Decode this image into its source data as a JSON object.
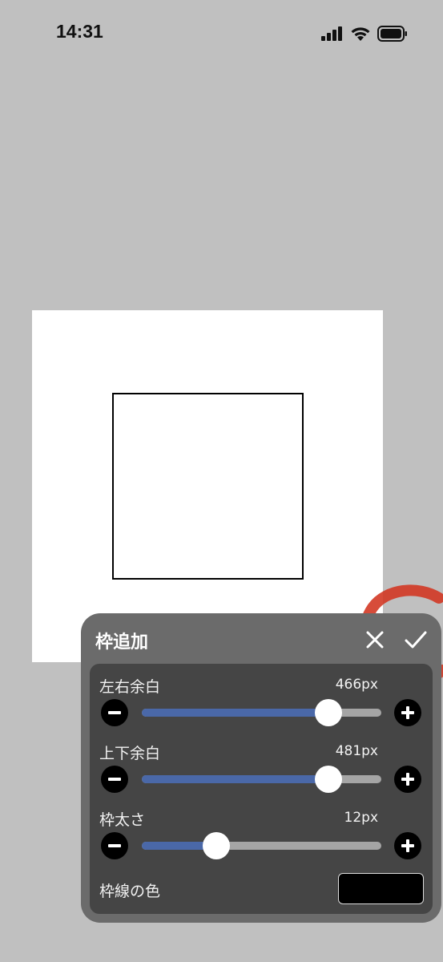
{
  "status_bar": {
    "time": "14:31",
    "icons": [
      "cellular-signal-icon",
      "wifi-icon",
      "battery-icon"
    ]
  },
  "canvas": {
    "background": "#ffffff",
    "frame_color": "#000000"
  },
  "panel": {
    "title": "枠追加",
    "close_icon": "close-icon",
    "confirm_icon": "checkmark-icon",
    "rows": [
      {
        "label": "左右余白",
        "value": "466px",
        "fill_fraction": 0.78
      },
      {
        "label": "上下余白",
        "value": "481px",
        "fill_fraction": 0.78
      },
      {
        "label": "枠太さ",
        "value": "12px",
        "fill_fraction": 0.31
      }
    ],
    "color_label": "枠線の色",
    "color_value": "#000000",
    "accent": "#4a68a8"
  }
}
